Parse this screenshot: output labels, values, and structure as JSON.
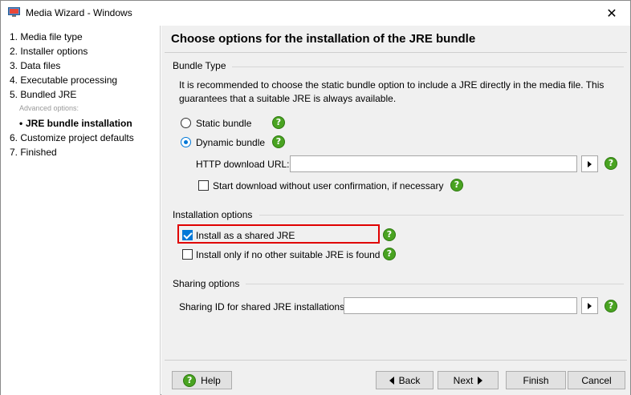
{
  "window": {
    "title": "Media Wizard - Windows",
    "close_glyph": "✕",
    "icon": "app-icon"
  },
  "sidebar": {
    "steps": [
      {
        "label": "1. Media file type"
      },
      {
        "label": "2. Installer options"
      },
      {
        "label": "3. Data files"
      },
      {
        "label": "4. Executable processing"
      },
      {
        "label": "5. Bundled JRE"
      },
      {
        "label": "Advanced options:"
      },
      {
        "label": "JRE bundle installation",
        "bullet": "•"
      },
      {
        "label": "6. Customize project defaults"
      },
      {
        "label": "7. Finished"
      }
    ]
  },
  "page": {
    "title": "Choose options for the installation of the JRE bundle"
  },
  "bundle_type": {
    "section_label": "Bundle Type",
    "description": "It is recommended to choose the static bundle option to include a JRE directly in the media file. This guarantees that a suitable JRE is always available.",
    "static_label": "Static bundle",
    "dynamic_label": "Dynamic bundle",
    "selected": "dynamic",
    "url_label": "HTTP download URL:",
    "url_value": "",
    "start_download_label": "Start download without user confirmation, if necessary",
    "start_download_checked": false
  },
  "installation_options": {
    "section_label": "Installation options",
    "shared_jre_label": "Install as a shared JRE",
    "shared_jre_checked": true,
    "only_if_none_label": "Install only if no other suitable JRE is found",
    "only_if_none_checked": false
  },
  "sharing_options": {
    "section_label": "Sharing options",
    "sharing_id_label": "Sharing ID for shared JRE installations:",
    "sharing_id_value": ""
  },
  "help_glyph": "?",
  "buttons": {
    "help": "Help",
    "back": "Back",
    "next": "Next",
    "finish": "Finish",
    "cancel": "Cancel"
  },
  "colors": {
    "accent": "#0078d7",
    "help_green": "#49a321",
    "highlight_red": "#e00000"
  }
}
